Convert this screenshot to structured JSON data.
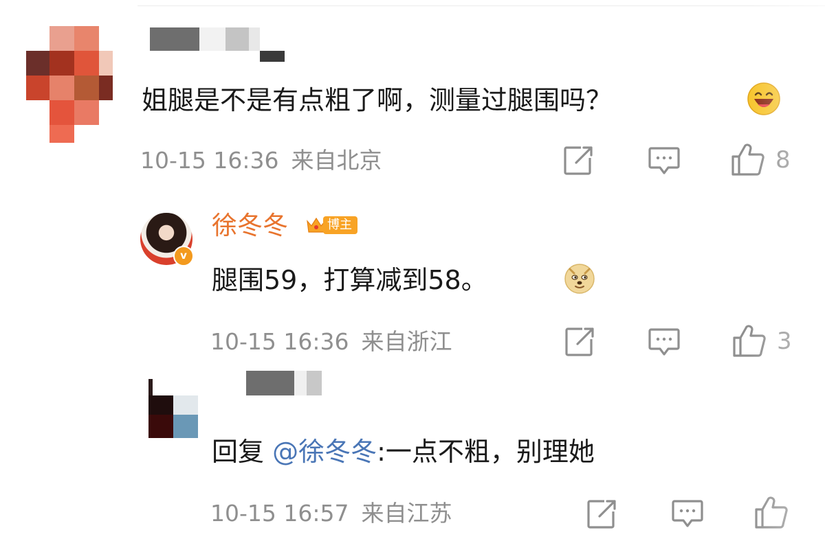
{
  "comments": [
    {
      "text": "姐腿是不是有点粗了啊，测量过腿围吗？",
      "time": "10-15 16:36",
      "location": "来自北京",
      "likes": "8",
      "emoji": "laughing-face-emoji"
    },
    {
      "username": "徐冬冬",
      "badge": "博主",
      "text": "腿围59，打算减到58。",
      "time": "10-15 16:36",
      "location": "来自浙江",
      "likes": "3",
      "emoji": "doge-emoji",
      "verified_mark": "v"
    },
    {
      "reply_prefix": "回复",
      "mention": "@徐冬冬",
      "text": ":一点不粗，别理她",
      "time": "10-15 16:57",
      "location": "来自江苏"
    }
  ],
  "colors": {
    "username": "#e8742e",
    "mention": "#4a76b6",
    "meta": "#8f8f8f",
    "badge": "#f8a325"
  },
  "icons": [
    "share-icon",
    "comment-icon",
    "like-icon"
  ]
}
